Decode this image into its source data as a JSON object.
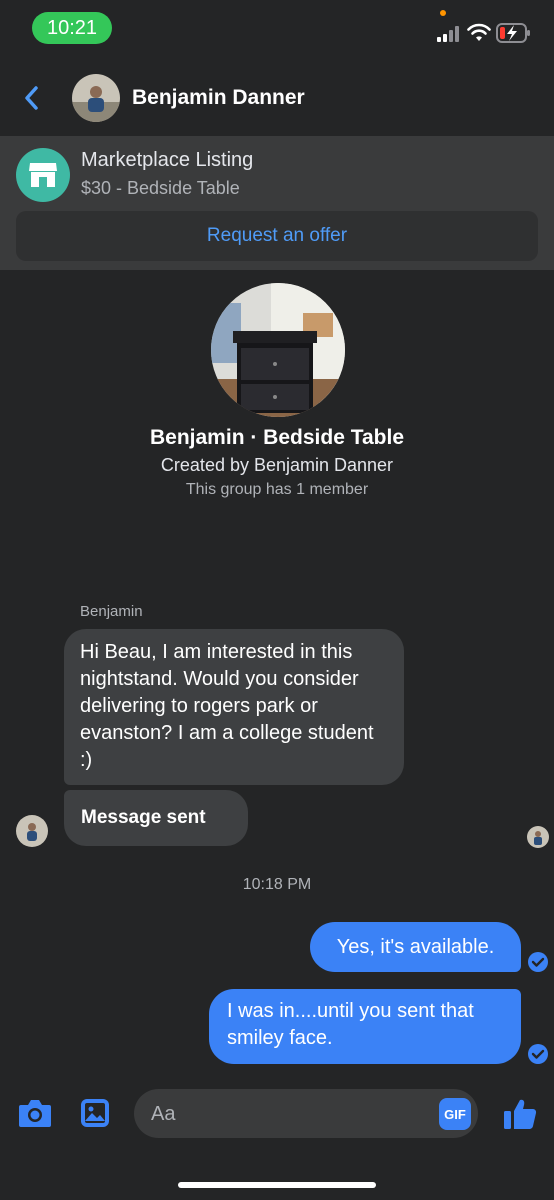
{
  "status_bar": {
    "time": "10:21"
  },
  "header": {
    "contact_name": "Benjamin Danner"
  },
  "marketplace": {
    "title": "Marketplace Listing",
    "subtitle": "$30 - Bedside Table",
    "offer_label": "Request an offer"
  },
  "group": {
    "title": "Benjamin · Bedside Table",
    "created_by": "Created by Benjamin Danner",
    "members": "This group has 1 member"
  },
  "messages": {
    "sender_name": "Benjamin",
    "incoming_1": "Hi Beau, I am interested in this nightstand. Would you consider delivering to rogers park or evanston? I am a college student :)",
    "incoming_2": "Message sent",
    "timestamp": "10:18 PM",
    "outgoing_1": "Yes, it's available.",
    "outgoing_2": "I was in....until you sent that smiley face."
  },
  "composer": {
    "placeholder": "Aa",
    "gif_label": "GIF"
  },
  "colors": {
    "accent": "#3b82f6",
    "link": "#4f9bf7",
    "marketplace": "#3fb9a4",
    "status_green": "#34c759"
  },
  "icons": [
    "back-chevron-icon",
    "marketplace-store-icon",
    "camera-icon",
    "gallery-icon",
    "gif-icon",
    "thumbs-up-icon",
    "read-check-icon"
  ]
}
